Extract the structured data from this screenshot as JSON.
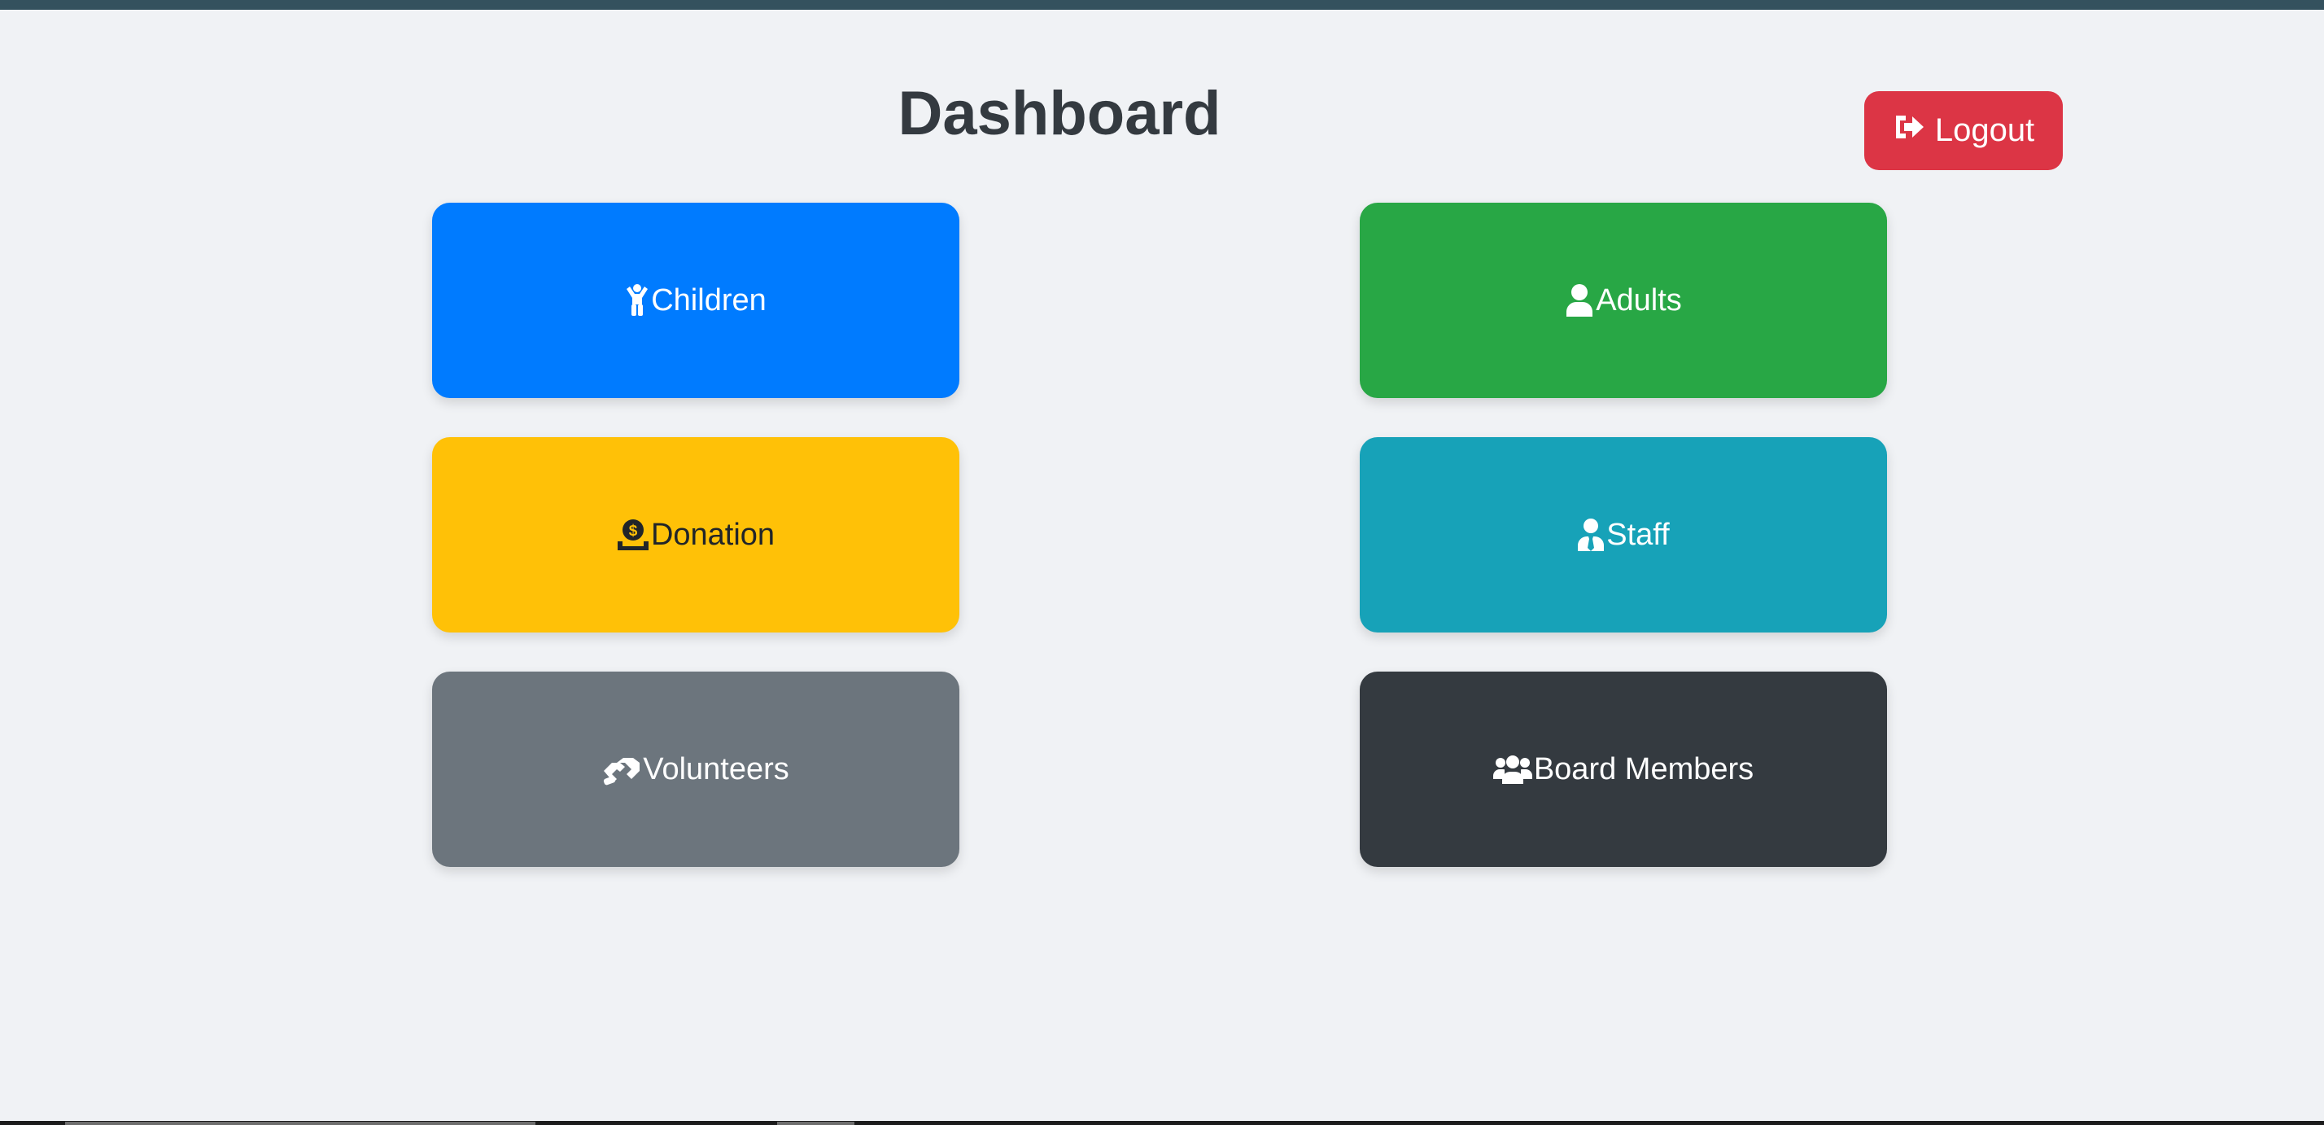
{
  "page": {
    "title": "Dashboard"
  },
  "header": {
    "logout_label": "Logout",
    "logout_icon": "sign-out-icon"
  },
  "tiles": [
    {
      "label": "Children",
      "icon": "child-icon",
      "color": "#007bff"
    },
    {
      "label": "Adults",
      "icon": "user-icon",
      "color": "#28a745"
    },
    {
      "label": "Donation",
      "icon": "donate-icon",
      "color": "#ffc107"
    },
    {
      "label": "Staff",
      "icon": "user-tie-icon",
      "color": "#17a2b8"
    },
    {
      "label": "Volunteers",
      "icon": "handshake-icon",
      "color": "#6c757d"
    },
    {
      "label": "Board Members",
      "icon": "users-icon",
      "color": "#343a40"
    }
  ],
  "colors": {
    "background": "#f0f2f5",
    "top_bar": "#34515e",
    "logout": "#dc3545",
    "title_text": "#343a40"
  }
}
